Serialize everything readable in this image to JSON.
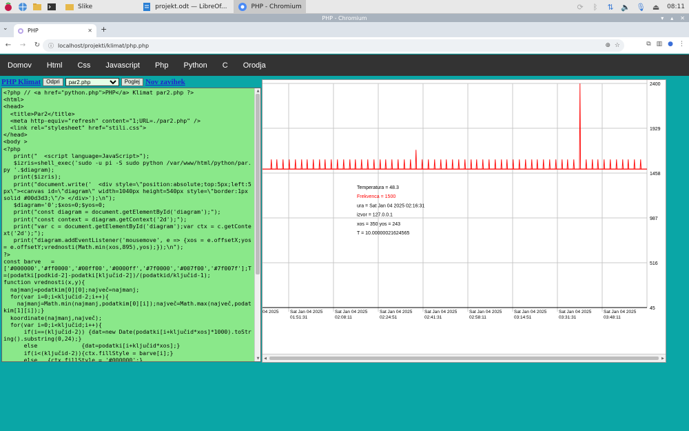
{
  "taskbar": {
    "windows": [
      {
        "label": "Slike",
        "icon": "folder-icon"
      },
      {
        "label": "projekt.odt — LibreOf...",
        "icon": "libreoffice-writer-icon"
      },
      {
        "label": "PHP - Chromium",
        "icon": "chromium-icon",
        "active": true
      }
    ],
    "clock": "08:11"
  },
  "window": {
    "title": "PHP - Chromium"
  },
  "browser": {
    "tab_title": "PHP",
    "url": "localhost/projekti/klimat/php.php"
  },
  "sitenav": {
    "items": [
      "Domov",
      "Html",
      "Css",
      "Javascript",
      "Php",
      "Python",
      "C",
      "Orodja"
    ]
  },
  "editor": {
    "brand": "PHP Klimat",
    "open_label": "Odpri",
    "file": "par2.php",
    "view_label": "Poglej",
    "new_tab_link": "Nov zavihek",
    "code": "<?php // <a href=\"python.php\">PHP</a> Klimat par2.php ?>\n<html>\n<head>\n  <title>Par2</title>\n  <meta http-equiv=\"refresh\" content=\"1;URL=./par2.php\" />\n  <link rel=\"stylesheet\" href=\"stili.css\">\n</head>\n<body >\n<?php\n   print(\"  <script language=JavaScript>\");\n   $izris=shell_exec('sudo -u pi -S sudo python /var/www/html/python/par.py '.$diagram);\n   print($izris);\n   print(\"document.write('  <div style=\\\"position:absolute;top:5px;left:5px\\\"><canvas id=\\\"diagram\\\" width=1040px height=540px style=\\\"border:1px solid #00d3d3;\\\"/> </div>');\\n\");\n   $diagram='0';$xos=0;$yos=0;\n   print(\"const diagram = document.getElementById('diagram');\");\n   print(\"const context = diagram.getContext('2d');\");\n   print(\"var c = document.getElementById('diagram');var ctx = c.getContext('2d');\");\n   print(\"diagram.addEventListener('mousemove', e => {xos = e.offsetX;yos = e.offsetY;vrednosti(Math.min(xos,895),yos);});\\n\");\n?>\nconst barve   =\n['#000000','#ff0000','#00ff00','#0000ff','#7f0000','#007f00','#7f007f'];T=(podatki[podkid-2]-podatki[ključid-2])/(podatkid/ključid-1);\nfunction vrednosti(x,y){\n  najmanj=podatkim[0][0];največ=najmanj;\n  for(var i=0;i<ključid-2;i++){\n    najmanj=Math.min(najmanj,podatkim[0][i]);največ=Math.max(največ,podatkim[1][i]);}\n  koordinate(najmanj,največ);\n  for(var i=0;i<ključid;i++){\n      if(i==(ključid-2)) {dat=new Date(podatki[i+ključid*xos]*1000).toString().substring(0,24);}\n      else             {dat=podatki[i+ključid*xos];}\n      if(i<(ključid-2)){ctx.fillStyle = barve[i];}\n      else   {ctx.fillStyle = '#000000';}\n      ctx.fillText(...)"
  },
  "chart_data": {
    "type": "line",
    "y_ticks": [
      "2400",
      "1929",
      "1458",
      "987",
      "516",
      "45"
    ],
    "ylim": [
      45,
      2400
    ],
    "x_ticks": [
      "04 2025",
      "Sat Jan 04 2025 01:51:31",
      "Sat Jan 04 2025 02:08:11",
      "Sat Jan 04 2025 02:24:51",
      "Sat Jan 04 2025 02:41:31",
      "Sat Jan 04 2025 02:58:11",
      "Sat Jan 04 2025 03:14:51",
      "Sat Jan 04 2025 03:31:31",
      "Sat Jan 04 2025 03:48:11"
    ],
    "series": [
      {
        "color": "#ff0000",
        "baseline": 1500,
        "spike_max": 2400
      }
    ],
    "tooltip": [
      {
        "text": "Temperatura = 48.3",
        "color": "#000000"
      },
      {
        "text": "Frekvenca = 1500",
        "color": "#ff0000"
      },
      {
        "text": "ura = Sat Jan 04 2025 02:16:31",
        "color": "#000000"
      },
      {
        "text": "izvor = 127.0.0.1",
        "color": "#000000"
      },
      {
        "text": "xos = 350 yos = 243",
        "color": "#000000"
      },
      {
        "text": "T = 10.00000021624565",
        "color": "#000000"
      }
    ]
  }
}
